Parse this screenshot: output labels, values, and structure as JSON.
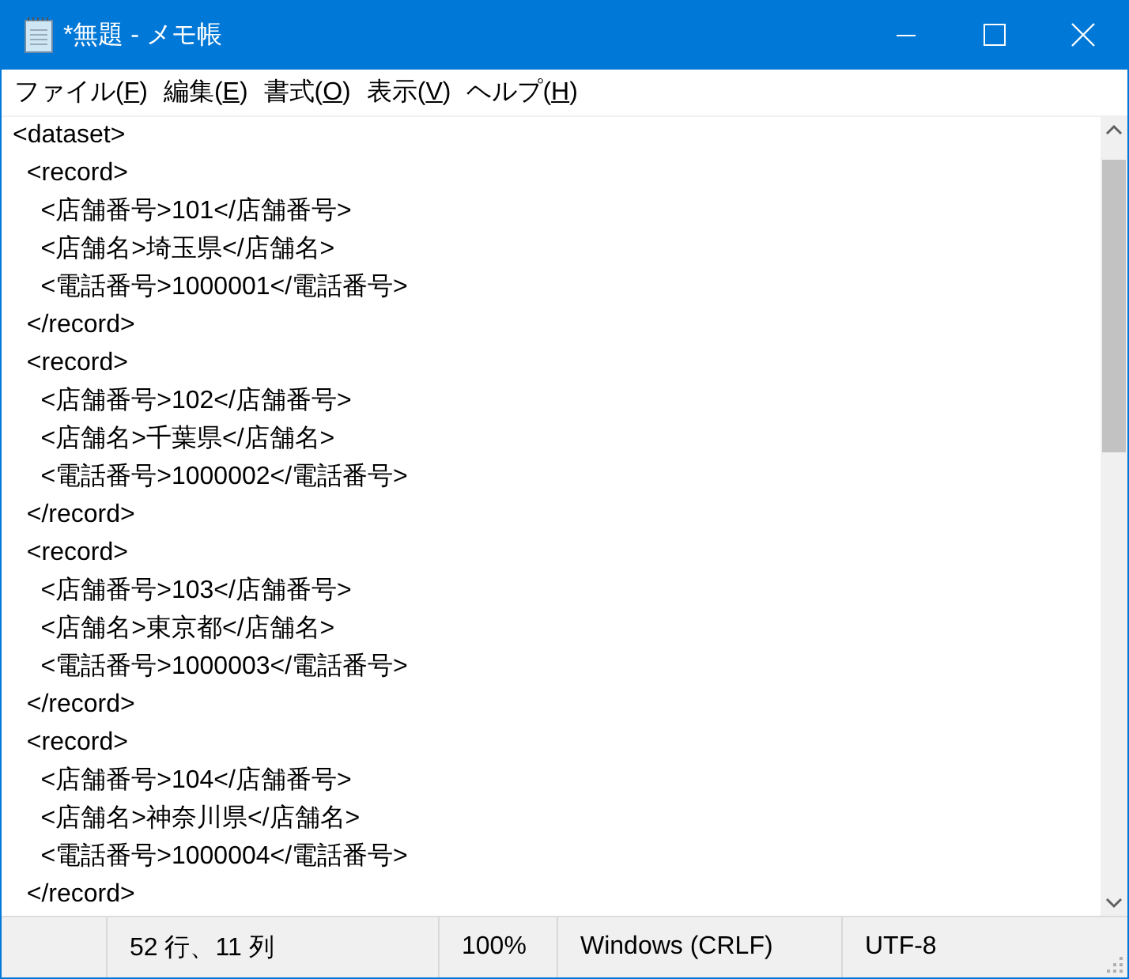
{
  "window": {
    "title": "*無題 - メモ帳"
  },
  "menu": [
    "ファイル(F)",
    "編集(E)",
    "書式(O)",
    "表示(V)",
    "ヘルプ(H)"
  ],
  "editor": {
    "lines": [
      "<dataset>",
      "  <record>",
      "    <店舗番号>101</店舗番号>",
      "    <店舗名>埼玉県</店舗名>",
      "    <電話番号>1000001</電話番号>",
      "  </record>",
      "  <record>",
      "    <店舗番号>102</店舗番号>",
      "    <店舗名>千葉県</店舗名>",
      "    <電話番号>1000002</電話番号>",
      "  </record>",
      "  <record>",
      "    <店舗番号>103</店舗番号>",
      "    <店舗名>東京都</店舗名>",
      "    <電話番号>1000003</電話番号>",
      "  </record>",
      "  <record>",
      "    <店舗番号>104</店舗番号>",
      "    <店舗名>神奈川県</店舗名>",
      "    <電話番号>1000004</電話番号>",
      "  </record>"
    ]
  },
  "status_bar": {
    "position": "52 行、11 列",
    "zoom": "100%",
    "line_ending": "Windows (CRLF)",
    "encoding": "UTF-8"
  }
}
